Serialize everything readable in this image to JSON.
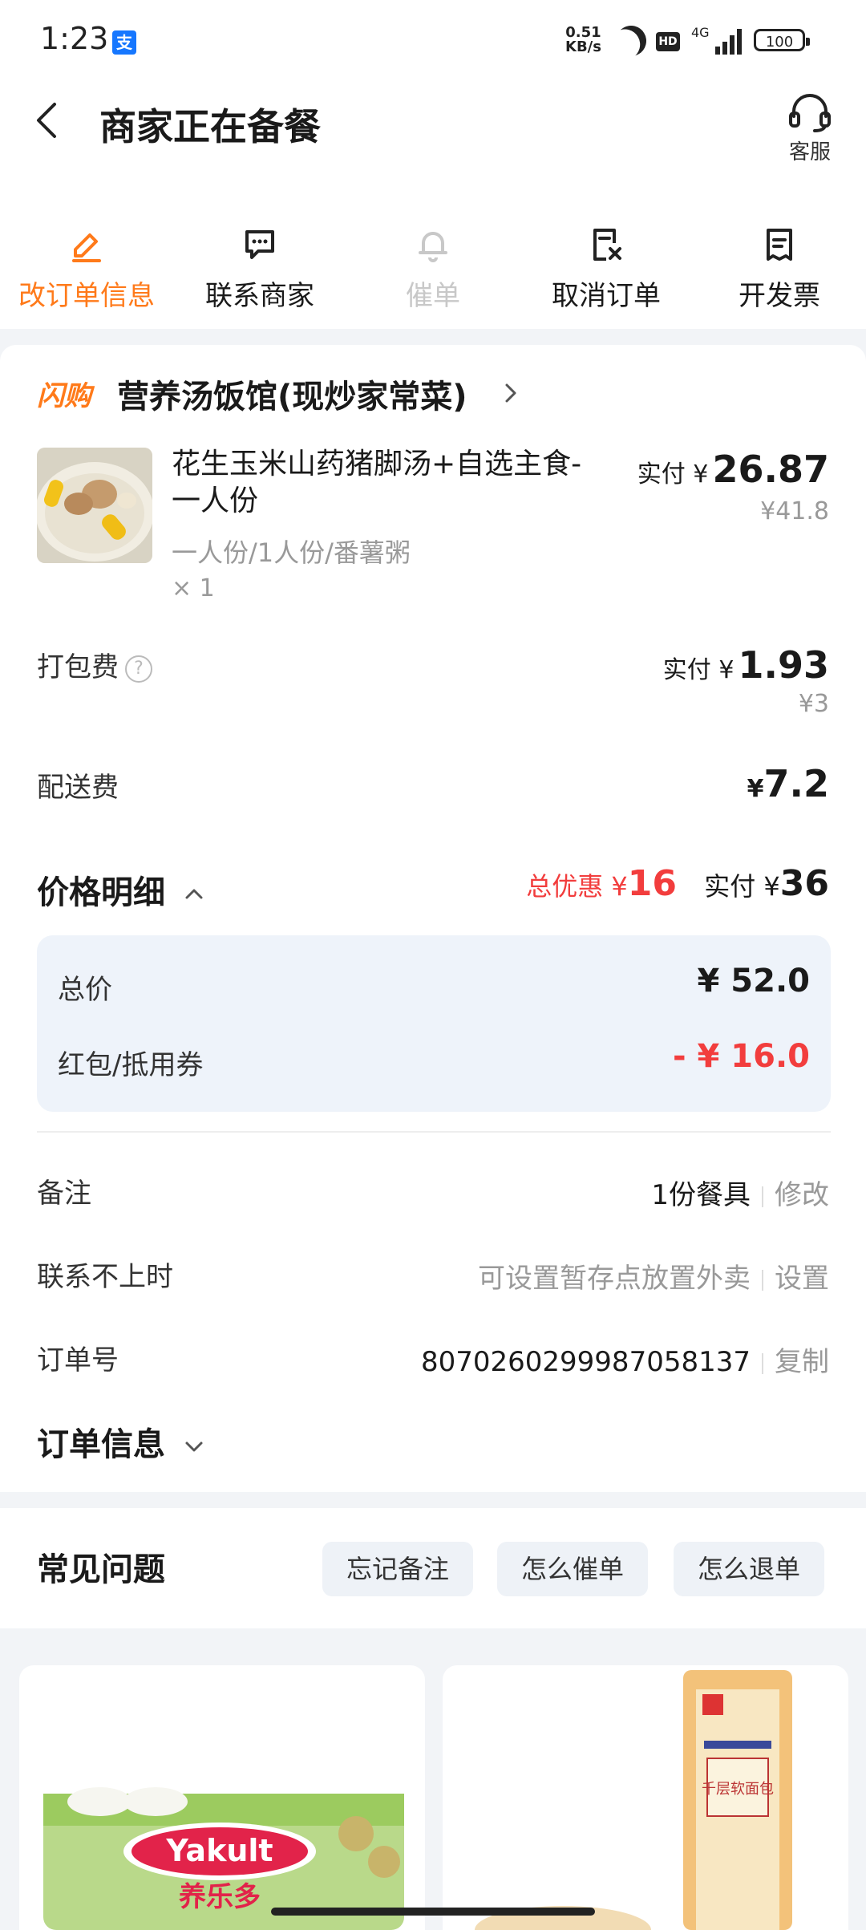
{
  "status_bar": {
    "time": "1:23",
    "alipay_icon": "支",
    "net_speed_value": "0.51",
    "net_speed_unit": "KB/s",
    "hd": "HD",
    "network": "4G",
    "battery": "100"
  },
  "header": {
    "title": "商家正在备餐",
    "service_label": "客服"
  },
  "actions": [
    {
      "label": "改订单信息",
      "icon": "edit-icon",
      "state": "active",
      "color": "#ff7a1a"
    },
    {
      "label": "联系商家",
      "icon": "chat-icon",
      "state": "normal"
    },
    {
      "label": "催单",
      "icon": "bell-icon",
      "state": "disabled"
    },
    {
      "label": "取消订单",
      "icon": "cancel-doc-icon",
      "state": "normal"
    },
    {
      "label": "开发票",
      "icon": "invoice-icon",
      "state": "normal"
    }
  ],
  "shop": {
    "tag": "闪购",
    "name": "营养汤饭馆(现炒家常菜)"
  },
  "item": {
    "name": "花生玉米山药猪脚汤+自选主食-一人份",
    "spec": "一人份/1人份/番薯粥",
    "qty": "× 1",
    "paid_label": "实付 ¥",
    "paid": "26.87",
    "original": "¥41.8"
  },
  "packing": {
    "label": "打包费",
    "help": "?",
    "paid_label": "实付 ¥",
    "paid": "1.93",
    "original": "¥3"
  },
  "delivery": {
    "label": "配送费",
    "currency": "¥",
    "value": "7.2"
  },
  "price_detail": {
    "title": "价格明细",
    "discount_label": "总优惠 ¥",
    "discount": "16",
    "paid_label": "实付 ¥",
    "paid": "36",
    "rows": [
      {
        "label": "总价",
        "value": "¥ 52.0"
      },
      {
        "label": "红包/抵用券",
        "value": "- ¥ 16.0"
      }
    ]
  },
  "info_rows": [
    {
      "label": "备注",
      "value": "1份餐具",
      "action": "修改"
    },
    {
      "label": "联系不上时",
      "value": "可设置暂存点放置外卖",
      "action": "设置"
    },
    {
      "label": "订单号",
      "value": "8070260299987058137",
      "action": "复制"
    }
  ],
  "order_info": {
    "title": "订单信息"
  },
  "faq": {
    "title": "常见问题",
    "chips": [
      "忘记备注",
      "怎么催单",
      "怎么退单"
    ]
  },
  "products": [
    {
      "brand": "Yakult",
      "brand_sub": "养乐多"
    },
    {
      "label": "千层软面包"
    }
  ],
  "colors": {
    "accent": "#ff7a1a",
    "discount": "#f23d3d",
    "panel": "#eef3fa"
  }
}
